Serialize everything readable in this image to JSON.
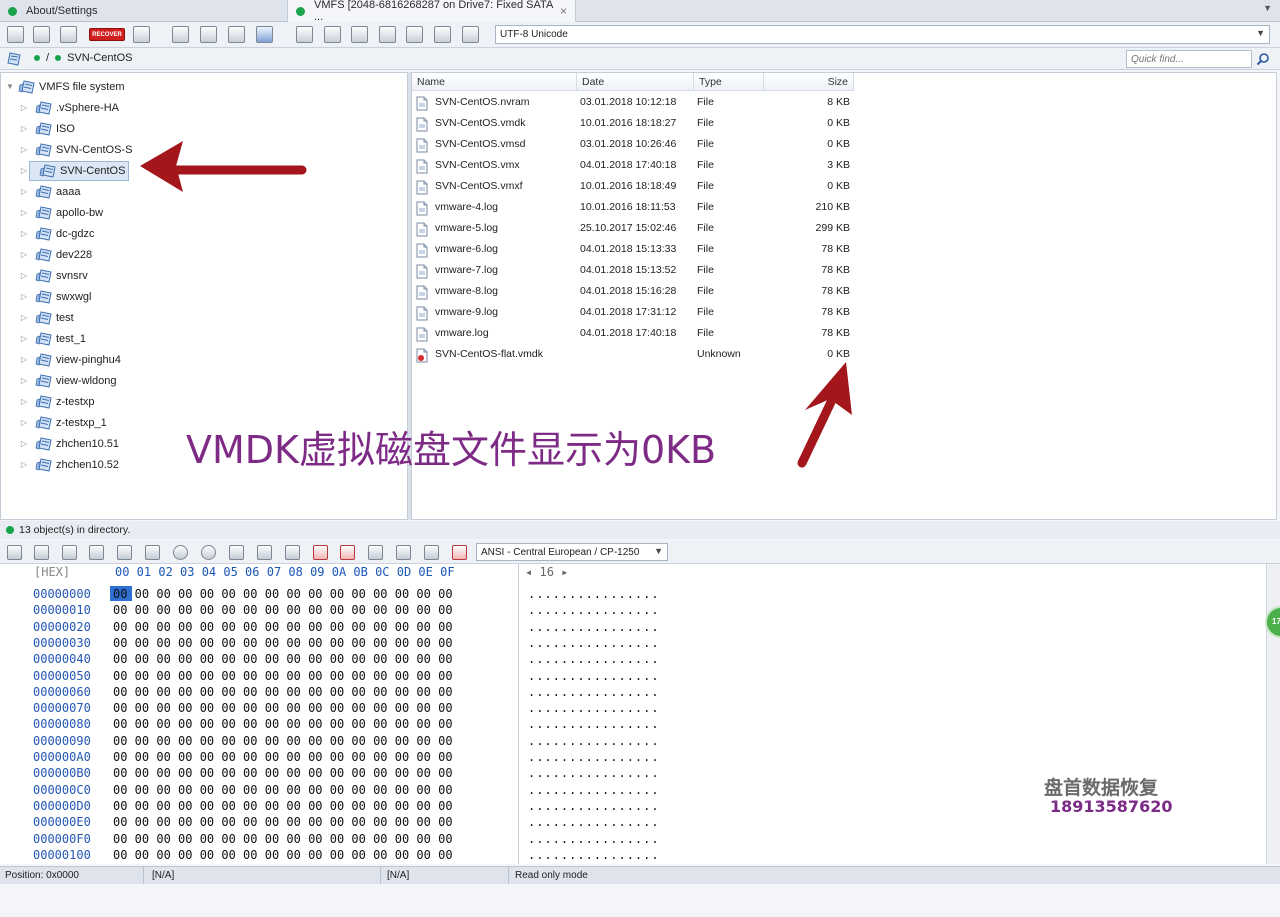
{
  "tabs": [
    {
      "label": "About/Settings"
    },
    {
      "label": "VMFS [2048-6816268287 on Drive7: Fixed SATA ...",
      "close": "×"
    }
  ],
  "toolbar": {
    "recover_label": "RECOVER",
    "encoding": "UTF-8 Unicode"
  },
  "address": {
    "sep": "/",
    "current": "SVN-CentOS",
    "search_placeholder": "Quick find..."
  },
  "tree": {
    "root": "VMFS file system",
    "items": [
      ".vSphere-HA",
      "ISO",
      "SVN-CentOS-S",
      "SVN-CentOS",
      "aaaa",
      "apollo-bw",
      "dc-gdzc",
      "dev228",
      "svnsrv",
      "swxwgl",
      "test",
      "test_1",
      "view-pinghu4",
      "view-wldong",
      "z-testxp",
      "z-testxp_1",
      "zhchen10.51",
      "zhchen10.52"
    ],
    "selected": "SVN-CentOS"
  },
  "file_list": {
    "columns": [
      "Name",
      "Date",
      "Type",
      "Size"
    ],
    "rows": [
      {
        "name": "SVN-CentOS.nvram",
        "date": "03.01.2018 10:12:18",
        "type": "File",
        "size": "8 KB"
      },
      {
        "name": "SVN-CentOS.vmdk",
        "date": "10.01.2016 18:18:27",
        "type": "File",
        "size": "0 KB"
      },
      {
        "name": "SVN-CentOS.vmsd",
        "date": "03.01.2018 10:26:46",
        "type": "File",
        "size": "0 KB"
      },
      {
        "name": "SVN-CentOS.vmx",
        "date": "04.01.2018 17:40:18",
        "type": "File",
        "size": "3 KB"
      },
      {
        "name": "SVN-CentOS.vmxf",
        "date": "10.01.2016 18:18:49",
        "type": "File",
        "size": "0 KB"
      },
      {
        "name": "vmware-4.log",
        "date": "10.01.2016 18:11:53",
        "type": "File",
        "size": "210 KB"
      },
      {
        "name": "vmware-5.log",
        "date": "25.10.2017 15:02:46",
        "type": "File",
        "size": "299 KB"
      },
      {
        "name": "vmware-6.log",
        "date": "04.01.2018 15:13:33",
        "type": "File",
        "size": "78 KB"
      },
      {
        "name": "vmware-7.log",
        "date": "04.01.2018 15:13:52",
        "type": "File",
        "size": "78 KB"
      },
      {
        "name": "vmware-8.log",
        "date": "04.01.2018 15:16:28",
        "type": "File",
        "size": "78 KB"
      },
      {
        "name": "vmware-9.log",
        "date": "04.01.2018 17:31:12",
        "type": "File",
        "size": "78 KB"
      },
      {
        "name": "vmware.log",
        "date": "04.01.2018 17:40:18",
        "type": "File",
        "size": "78 KB"
      },
      {
        "name": "SVN-CentOS-flat.vmdk",
        "date": "",
        "type": "Unknown",
        "size": "0 KB"
      }
    ]
  },
  "status": {
    "objects": "13 object(s) in directory."
  },
  "hex": {
    "encoding": "ANSI - Central European / CP-1250",
    "label": "[HEX]",
    "columns": "00 01 02 03 04 05 06 07 08 09 0A 0B 0C 0D 0E 0F",
    "width_prev": "◂",
    "width": "16",
    "width_next": "▸",
    "offsets": [
      "00000000",
      "00000010",
      "00000020",
      "00000030",
      "00000040",
      "00000050",
      "00000060",
      "00000070",
      "00000080",
      "00000090",
      "000000A0",
      "000000B0",
      "000000C0",
      "000000D0",
      "000000E0",
      "000000F0",
      "00000100"
    ],
    "bytes": "00 00 00 00 00 00 00 00 00 00 00 00 00 00 00 00",
    "ascii": "................",
    "side_badge": "17"
  },
  "statusbar": {
    "position": "Position: 0x0000",
    "field2": "[N/A]",
    "field3": "[N/A]",
    "mode": "Read only mode"
  },
  "annotation": {
    "caption": "VMDK虚拟磁盘文件显示为0KB",
    "watermark_name": "盘首数据恢复",
    "watermark_phone": "18913587620"
  },
  "colors": {
    "arrow": "#a3161b",
    "caption": "#7e2b86",
    "accent_blue": "#2457b4",
    "status_green": "#19a34a"
  }
}
